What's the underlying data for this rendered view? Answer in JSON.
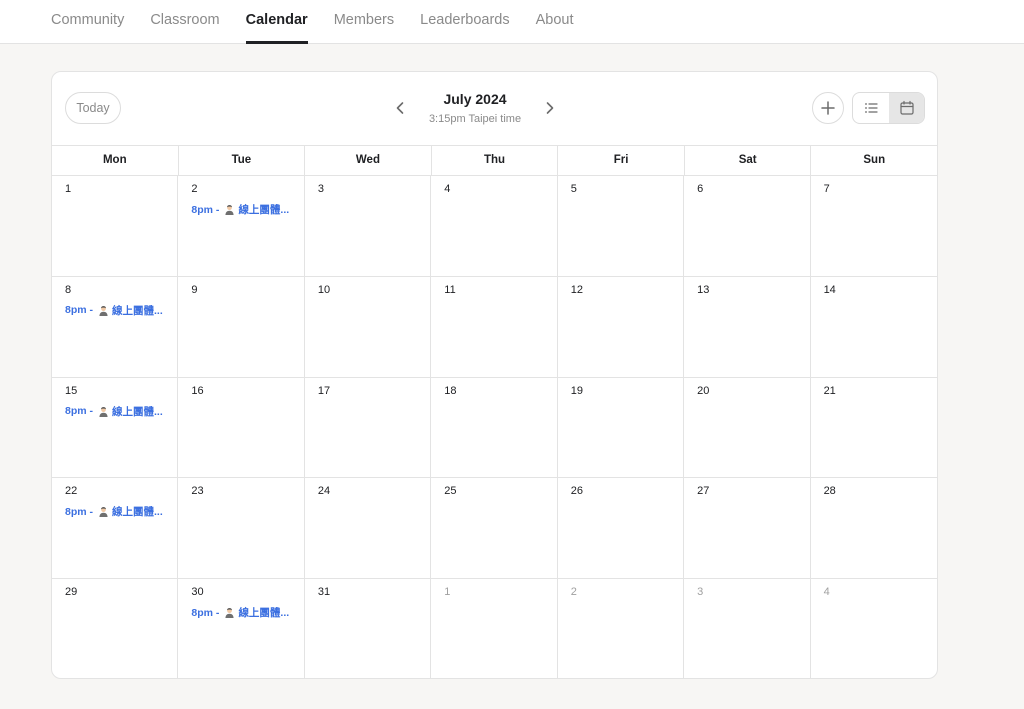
{
  "nav": {
    "tabs": [
      {
        "label": "Community",
        "active": false
      },
      {
        "label": "Classroom",
        "active": false
      },
      {
        "label": "Calendar",
        "active": true
      },
      {
        "label": "Members",
        "active": false
      },
      {
        "label": "Leaderboards",
        "active": false
      },
      {
        "label": "About",
        "active": false
      }
    ]
  },
  "calendar": {
    "today_label": "Today",
    "month_title": "July 2024",
    "timezone_text": "3:15pm Taipei time",
    "weekdays": [
      "Mon",
      "Tue",
      "Wed",
      "Thu",
      "Fri",
      "Sat",
      "Sun"
    ],
    "accent_color": "#3b6fe0",
    "days": [
      {
        "num": "1",
        "other": false,
        "event": null
      },
      {
        "num": "2",
        "other": false,
        "event": {
          "time": "8pm -",
          "title": "線上團體..."
        }
      },
      {
        "num": "3",
        "other": false,
        "event": null
      },
      {
        "num": "4",
        "other": false,
        "event": null
      },
      {
        "num": "5",
        "other": false,
        "event": null
      },
      {
        "num": "6",
        "other": false,
        "event": null
      },
      {
        "num": "7",
        "other": false,
        "event": null
      },
      {
        "num": "8",
        "other": false,
        "event": {
          "time": "8pm -",
          "title": "線上團體..."
        }
      },
      {
        "num": "9",
        "other": false,
        "event": null
      },
      {
        "num": "10",
        "other": false,
        "event": null
      },
      {
        "num": "11",
        "other": false,
        "event": null
      },
      {
        "num": "12",
        "other": false,
        "event": null
      },
      {
        "num": "13",
        "other": false,
        "event": null
      },
      {
        "num": "14",
        "other": false,
        "event": null
      },
      {
        "num": "15",
        "other": false,
        "event": {
          "time": "8pm -",
          "title": "線上團體..."
        }
      },
      {
        "num": "16",
        "other": false,
        "event": null
      },
      {
        "num": "17",
        "other": false,
        "event": null
      },
      {
        "num": "18",
        "other": false,
        "event": null
      },
      {
        "num": "19",
        "other": false,
        "event": null
      },
      {
        "num": "20",
        "other": false,
        "event": null
      },
      {
        "num": "21",
        "other": false,
        "event": null
      },
      {
        "num": "22",
        "other": false,
        "event": {
          "time": "8pm -",
          "title": "線上團體..."
        }
      },
      {
        "num": "23",
        "other": false,
        "event": null
      },
      {
        "num": "24",
        "other": false,
        "event": null
      },
      {
        "num": "25",
        "other": false,
        "event": null
      },
      {
        "num": "26",
        "other": false,
        "event": null
      },
      {
        "num": "27",
        "other": false,
        "event": null
      },
      {
        "num": "28",
        "other": false,
        "event": null
      },
      {
        "num": "29",
        "other": false,
        "event": null
      },
      {
        "num": "30",
        "other": false,
        "event": {
          "time": "8pm -",
          "title": "線上團體..."
        }
      },
      {
        "num": "31",
        "other": false,
        "event": null
      },
      {
        "num": "1",
        "other": true,
        "event": null
      },
      {
        "num": "2",
        "other": true,
        "event": null
      },
      {
        "num": "3",
        "other": true,
        "event": null
      },
      {
        "num": "4",
        "other": true,
        "event": null
      }
    ]
  },
  "icons": {
    "prev": "chevron-left-icon",
    "next": "chevron-right-icon",
    "add": "plus-icon",
    "list_view": "list-icon",
    "calendar_view": "calendar-icon",
    "event_person": "person-emoji-icon"
  }
}
